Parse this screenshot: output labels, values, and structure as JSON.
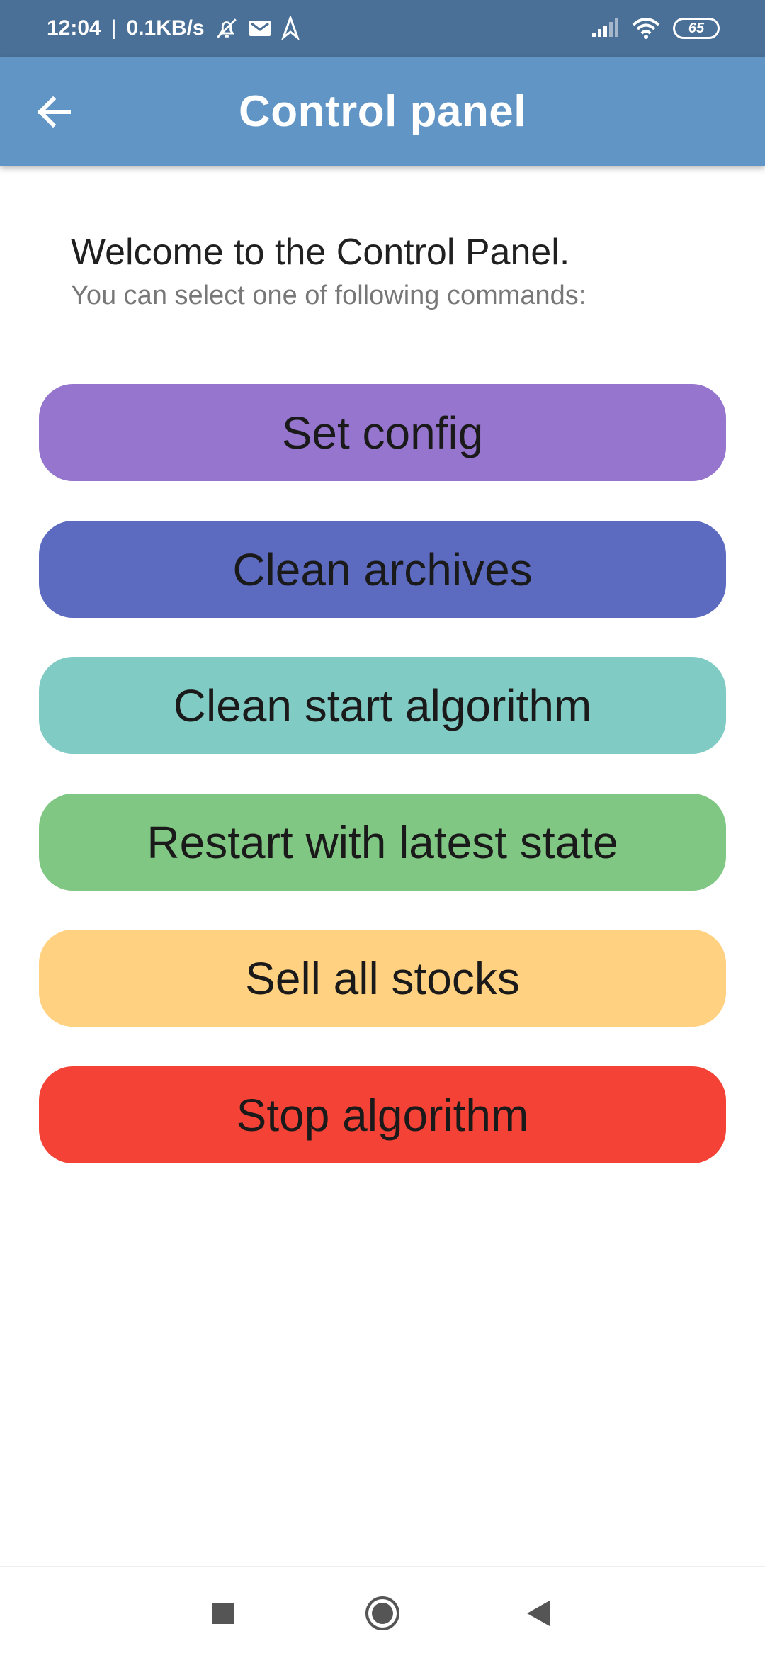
{
  "status_bar": {
    "time": "12:04",
    "separator": "|",
    "speed": "0.1KB/s",
    "battery": "65",
    "icons": [
      "alarm-off-icon",
      "mail-icon",
      "location-arrow-icon",
      "signal-icon",
      "wifi-icon",
      "battery-icon"
    ]
  },
  "app_bar": {
    "title": "Control panel",
    "back_icon": "arrow-back-icon"
  },
  "content": {
    "welcome": "Welcome to the Control Panel.",
    "subtitle": "You can select one of following commands:"
  },
  "commands": [
    {
      "label": "Set config",
      "color": "#9575cd"
    },
    {
      "label": "Clean archives",
      "color": "#5c6bc0"
    },
    {
      "label": "Clean start algorithm",
      "color": "#80cbc4"
    },
    {
      "label": "Restart with latest state",
      "color": "#81c784"
    },
    {
      "label": "Sell all stocks",
      "color": "#ffd180"
    },
    {
      "label": "Stop algorithm",
      "color": "#f44336"
    }
  ],
  "nav_bar": {
    "icons": [
      "recents-square-icon",
      "home-circle-icon",
      "back-triangle-icon"
    ]
  },
  "colors": {
    "status_bar": "#4a7097",
    "app_bar": "#6195c5"
  }
}
